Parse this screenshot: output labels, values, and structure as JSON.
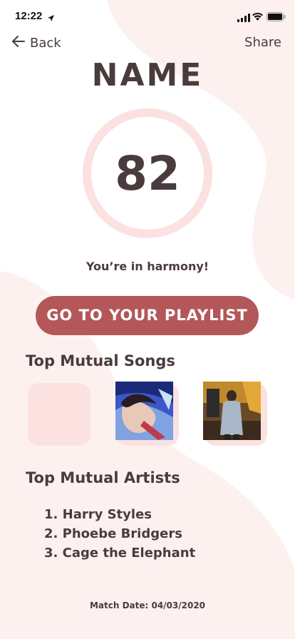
{
  "status_bar": {
    "time": "12:22"
  },
  "nav": {
    "back_label": "Back",
    "share_label": "Share"
  },
  "match": {
    "name": "NAME",
    "score": "82",
    "message": "You’re in harmony!"
  },
  "playlist_button": {
    "label": "GO TO YOUR PLAYLIST"
  },
  "songs_section": {
    "title": "Top Mutual Songs"
  },
  "artists_section": {
    "title": "Top Mutual Artists",
    "items": [
      {
        "label": "1. Harry Styles"
      },
      {
        "label": "2. Phoebe Bridgers"
      },
      {
        "label": "3. Cage the Elephant"
      }
    ]
  },
  "footer": {
    "match_date": "Match Date: 04/03/2020"
  },
  "colors": {
    "text": "#4a3b3d",
    "accent": "#b35758",
    "ring": "#fce1e1",
    "background_blob": "#fdf1f0"
  },
  "icons": {
    "back": "arrow-left-icon",
    "location": "location-arrow-icon",
    "signal": "cellular-signal-icon",
    "wifi": "wifi-icon",
    "battery": "battery-icon"
  }
}
